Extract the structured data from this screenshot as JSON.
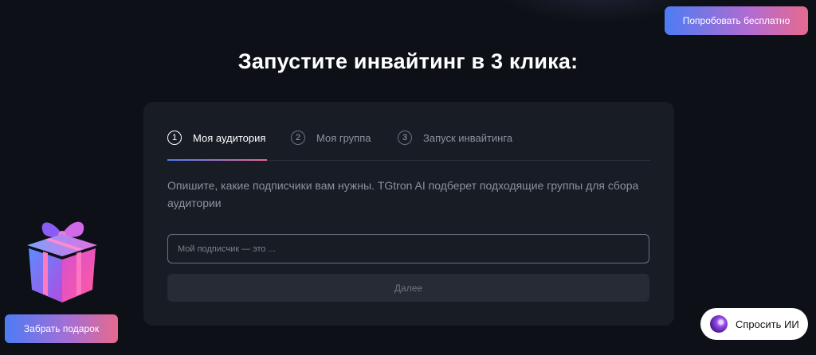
{
  "header": {
    "cta_label": "Попробовать бесплатно"
  },
  "main": {
    "title": "Запустите инвайтинг в 3 клика:"
  },
  "steps": [
    {
      "num": "1",
      "label": "Моя аудитория",
      "active": true
    },
    {
      "num": "2",
      "label": "Моя группа",
      "active": false
    },
    {
      "num": "3",
      "label": "Запуск инвайтинга",
      "active": false
    }
  ],
  "form": {
    "description": "Опишите, какие подписчики вам нужны. TGtron AI подберет подходящие группы для сбора аудитории",
    "input_value": "",
    "input_placeholder": "Мой подписчик — это ...",
    "next_label": "Далее"
  },
  "gift": {
    "button_label": "Забрать подарок",
    "icon": "gift-icon"
  },
  "ai": {
    "button_label": "Спросить ИИ",
    "icon": "ai-orb-icon"
  },
  "colors": {
    "background": "#0d1016",
    "card": "#181c24",
    "gradient_start": "#4d7cf4",
    "gradient_end": "#e66a8e"
  }
}
